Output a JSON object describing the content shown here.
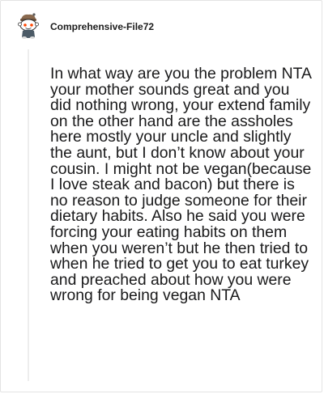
{
  "comment": {
    "author": "Comprehensive-File72",
    "body": "In what way are you the problem NTA your mother sounds great and you did nothing wrong, your extend family on the other hand are the assholes here mostly your uncle and slightly the aunt, but I don’t know about your cousin. I might not be vegan(because I love steak and bacon) but there is no reason to judge someone for their dietary habits. Also he said you were forcing your eating habits on them when you weren’t but he then tried to when he tried to get you to eat turkey and preached about how you were wrong for being vegan NTA",
    "avatar_icon": "snoo-avatar-icon"
  }
}
